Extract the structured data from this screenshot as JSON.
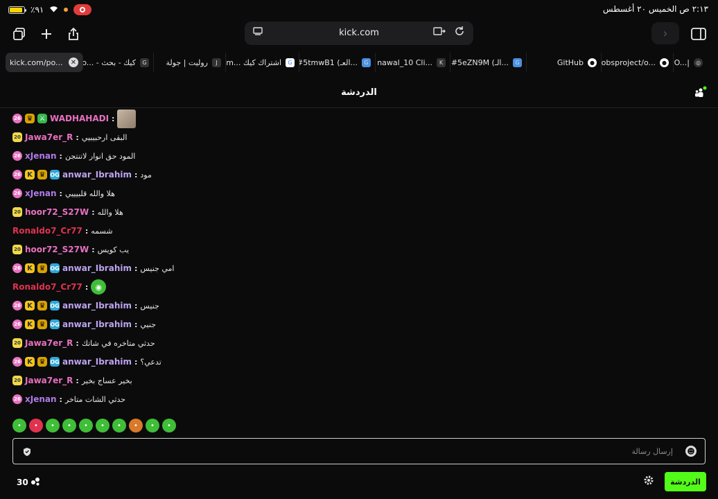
{
  "status_bar": {
    "battery_text": "٪٩١",
    "datetime": "٢:١٣ ص  الخميس ٢٠ أغسطس"
  },
  "browser": {
    "url": "kick.com",
    "tabs": [
      {
        "label": "kick.com/po...",
        "active": true,
        "icon": "close-icon"
      },
      {
        "label": "Go... - كيك - بحث",
        "fav": "G"
      },
      {
        "label": "روليت | جولة",
        "fav": "J"
      },
      {
        "label": "tm... اشتراك كيك",
        "fav": "G"
      },
      {
        "label": "#5tmwB1 (العـ...",
        "fav": "G"
      },
      {
        "label": "nawal_10 Cli...",
        "fav": "K"
      },
      {
        "label": "#5eZN9M (الـ...",
        "fav": "G"
      },
      {
        "label": "GitHub",
        "fav": "gh"
      },
      {
        "label": "obsproject/o...",
        "fav": "gh"
      },
      {
        "label": "O...|",
        "fav": "o"
      }
    ]
  },
  "chat": {
    "title": "الدردشة",
    "messages": [
      {
        "user": "WADHAHADI",
        "color": "#e870c0",
        "text": "",
        "badges": [
          "pink",
          "crown",
          "mod"
        ],
        "sep": ":",
        "avatar": true
      },
      {
        "user": "Jawa7er_R",
        "color": "#e870c0",
        "text": "البقى ارحبيبيي",
        "badges": [
          "sub"
        ],
        "sep": ":"
      },
      {
        "user": "xJenan",
        "color": "#b07be8",
        "text": "المود حق انوار لاتنتجن",
        "badges": [
          "pink"
        ],
        "sep": ":"
      },
      {
        "user": "anwar_Ibrahim",
        "color": "#bda4f0",
        "text": "مود",
        "badges": [
          "pink",
          "k",
          "crown",
          "og"
        ],
        "sep": ":"
      },
      {
        "user": "xJenan",
        "color": "#b07be8",
        "text": "هلا والله قلبيييي",
        "badges": [
          "pink"
        ],
        "sep": ":"
      },
      {
        "user": "hoor72_S27W",
        "color": "#e870c0",
        "text": "هلا والله",
        "badges": [
          "sub"
        ],
        "sep": ":"
      },
      {
        "user": "Ronaldo7_Cr77",
        "color": "#e0334f",
        "text": "شسمه",
        "badges": [],
        "sep": ":"
      },
      {
        "user": "hoor72_S27W",
        "color": "#e870c0",
        "text": "يب كويس",
        "badges": [
          "sub"
        ],
        "sep": ":"
      },
      {
        "user": "anwar_Ibrahim",
        "color": "#bda4f0",
        "text": "امي جنيس",
        "badges": [
          "pink",
          "k",
          "crown",
          "og"
        ],
        "sep": ":"
      },
      {
        "user": "Ronaldo7_Cr77",
        "color": "#e0334f",
        "text": "",
        "badges": [],
        "sep": ":",
        "emote": true
      },
      {
        "user": "anwar_Ibrahim",
        "color": "#bda4f0",
        "text": "جنيس",
        "badges": [
          "pink",
          "k",
          "crown",
          "og"
        ],
        "sep": ":"
      },
      {
        "user": "anwar_Ibrahim",
        "color": "#bda4f0",
        "text": "جنيي",
        "badges": [
          "pink",
          "k",
          "crown",
          "og"
        ],
        "sep": ":"
      },
      {
        "user": "Jawa7er_R",
        "color": "#e870c0",
        "text": "حدثي متاخره في شاتك",
        "badges": [
          "sub"
        ],
        "sep": ":"
      },
      {
        "user": "anwar_Ibrahim",
        "color": "#bda4f0",
        "text": "تدعي؟",
        "badges": [
          "pink",
          "k",
          "crown",
          "og"
        ],
        "sep": ":"
      },
      {
        "user": "Jawa7er_R",
        "color": "#e870c0",
        "text": "بخير عساج بخير",
        "badges": [
          "sub"
        ],
        "sep": ":"
      },
      {
        "user": "xJenan",
        "color": "#b07be8",
        "text": "حدثي الشات متاخر",
        "badges": [
          "pink"
        ],
        "sep": ":"
      }
    ],
    "emotes": [
      "#3fbe37",
      "#e0334f",
      "#3fbe37",
      "#3fbe37",
      "#3fbe37",
      "#3fbe37",
      "#3fbe37",
      "#d97a2a",
      "#3fbe37",
      "#3fbe37"
    ],
    "input_placeholder": "إرسال رسالة",
    "viewers": "30",
    "send_label": "الدردشة"
  },
  "colors": {
    "accent": "#53fc18",
    "background": "#0b0b0c"
  }
}
